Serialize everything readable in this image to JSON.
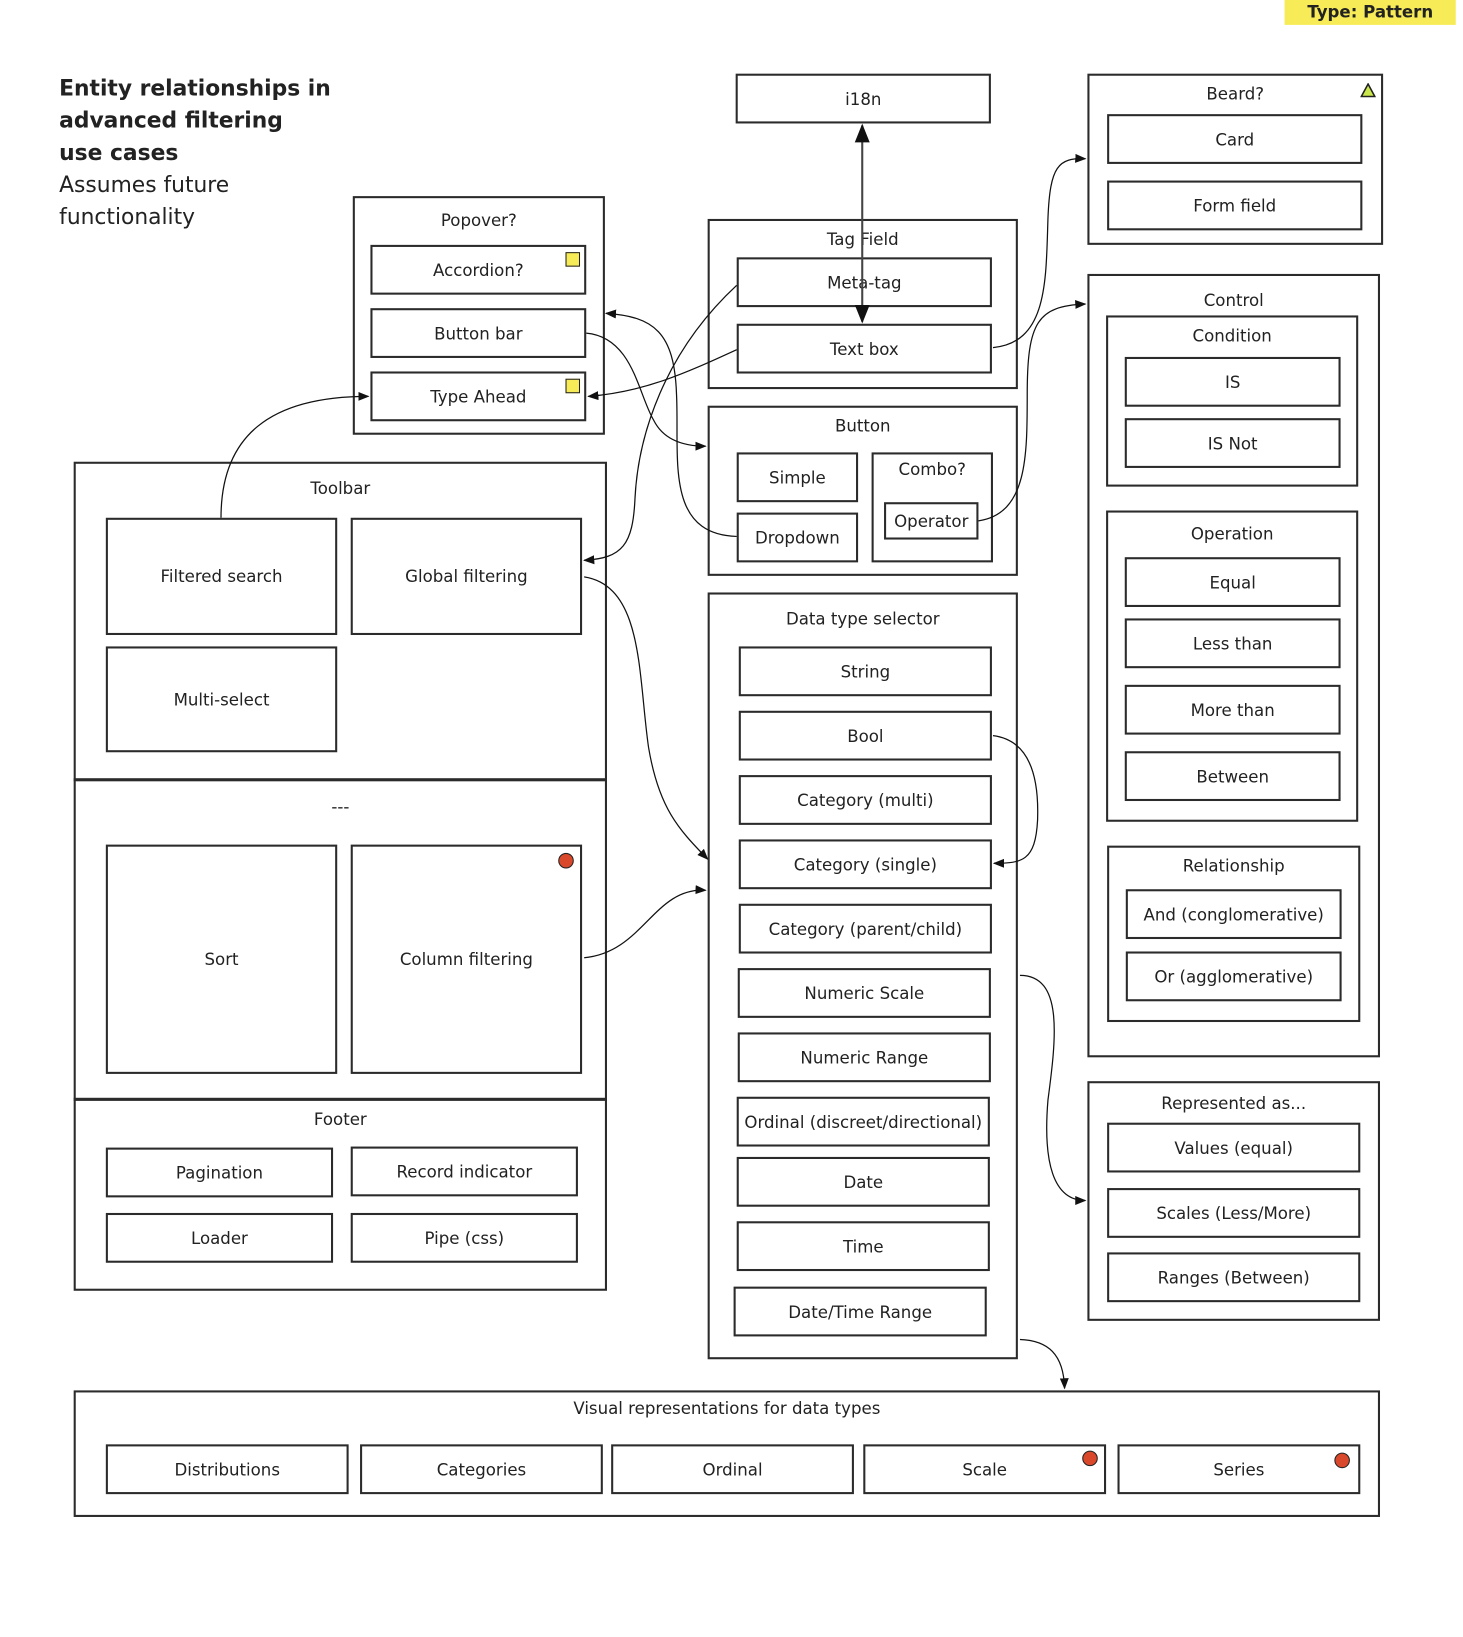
{
  "badge": "Type: Pattern",
  "title": {
    "bold_lines": [
      "Entity relationships in",
      "advanced filtering",
      "use cases"
    ],
    "normal_lines": [
      "Assumes future",
      "functionality"
    ]
  },
  "i18n": "i18n",
  "popover": {
    "title": "Popover?",
    "items": [
      "Accordion?",
      "Button bar",
      "Type Ahead"
    ]
  },
  "tag_field": {
    "title": "Tag Field",
    "items": [
      "Meta-tag",
      "Text box"
    ]
  },
  "button": {
    "title": "Button",
    "simple": "Simple",
    "dropdown": "Dropdown",
    "combo": {
      "title": "Combo?",
      "operator": "Operator"
    }
  },
  "beard": {
    "title": "Beard?",
    "items": [
      "Card",
      "Form field"
    ]
  },
  "control": {
    "title": "Control",
    "condition": {
      "title": "Condition",
      "items": [
        "IS",
        "IS Not"
      ]
    },
    "operation": {
      "title": "Operation",
      "items": [
        "Equal",
        "Less than",
        "More than",
        "Between"
      ]
    },
    "relationship": {
      "title": "Relationship",
      "items": [
        "And (conglomerative)",
        "Or (agglomerative)"
      ]
    }
  },
  "toolbar": {
    "title": "Toolbar",
    "items": [
      "Filtered search",
      "Global filtering",
      "Multi-select"
    ]
  },
  "middle_section": {
    "title": "---",
    "items": [
      "Sort",
      "Column filtering"
    ]
  },
  "footer": {
    "title": "Footer",
    "items": [
      "Pagination",
      "Record indicator",
      "Loader",
      "Pipe (css)"
    ]
  },
  "data_type_selector": {
    "title": "Data type selector",
    "items": [
      "String",
      "Bool",
      "Category (multi)",
      "Category (single)",
      "Category (parent/child)",
      "Numeric Scale",
      "Numeric Range",
      "Ordinal (discreet/directional)",
      "Date",
      "Time",
      "Date/Time Range"
    ]
  },
  "represented_as": {
    "title": "Represented as...",
    "items": [
      "Values (equal)",
      "Scales (Less/More)",
      "Ranges (Between)"
    ]
  },
  "visual_representations": {
    "title": "Visual representations for data types",
    "items": [
      "Distributions",
      "Categories",
      "Ordinal",
      "Scale",
      "Series"
    ]
  },
  "markers": {
    "yellow_square": "#f7ec57",
    "red_dot": "#d9482a",
    "green_triangle": "#c9e64a"
  }
}
